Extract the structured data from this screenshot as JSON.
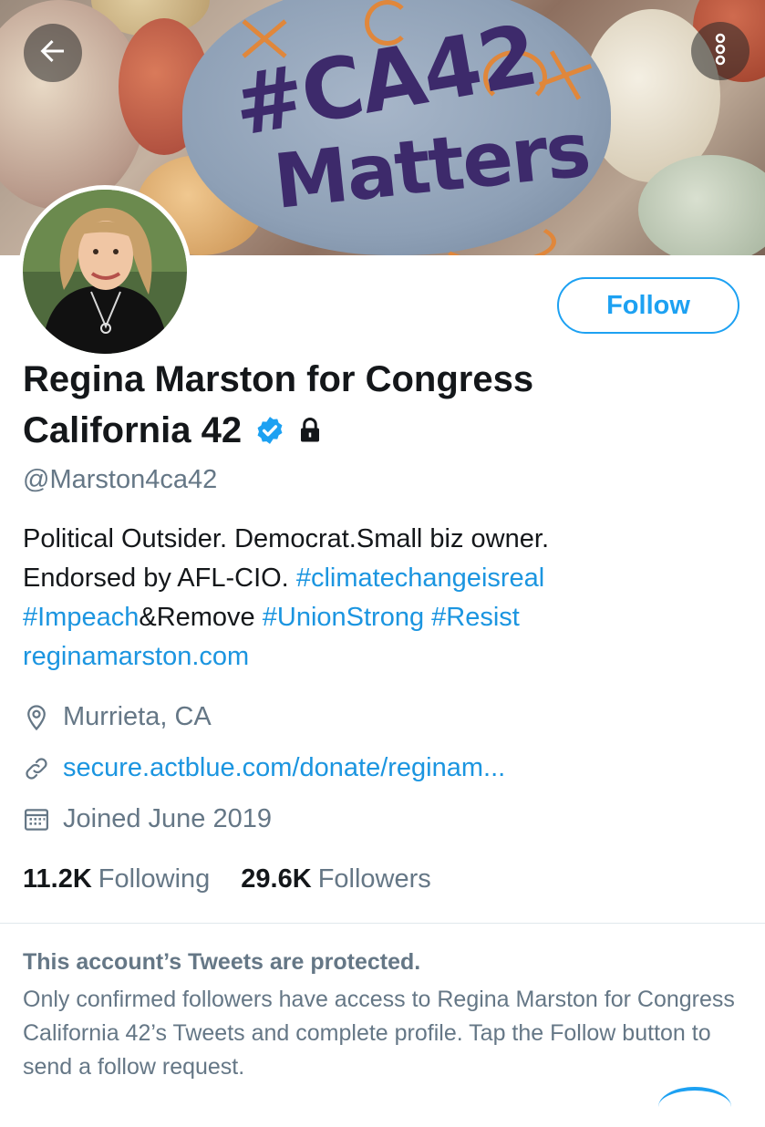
{
  "banner": {
    "stone_text_line1": "#CA42",
    "stone_text_line2": "Matters"
  },
  "header": {
    "back_icon": "arrow-left-icon",
    "more_icon": "more-vertical-icon"
  },
  "profile": {
    "follow_label": "Follow",
    "name_line1": "Regina Marston for Congress",
    "name_line2": "California 42",
    "handle": "@Marston4ca42",
    "bio": {
      "line1": "Political Outsider. Democrat.Small biz owner.",
      "line2_text": "Endorsed by AFL-CIO. ",
      "line2_hashtag": "#climatechangeisreal",
      "line3_hashtag1": "#Impeach",
      "line3_text": "&Remove ",
      "line3_hashtag2": "#UnionStrong",
      "line3_hashtag3": "#Resist",
      "line4_link": "reginamarston.com"
    },
    "location": "Murrieta, CA",
    "website": "secure.actblue.com/donate/reginam...",
    "joined": "Joined June 2019",
    "following_count": "11.2K",
    "following_label": "Following",
    "followers_count": "29.6K",
    "followers_label": "Followers"
  },
  "protected": {
    "title": "This account’s Tweets are protected.",
    "body": "Only confirmed followers have access to Regina Marston for Congress California 42’s Tweets and complete profile. Tap the Follow button to send a follow request."
  },
  "colors": {
    "accent": "#1da1f2",
    "link": "#1b95e0",
    "secondary_text": "#657786"
  }
}
